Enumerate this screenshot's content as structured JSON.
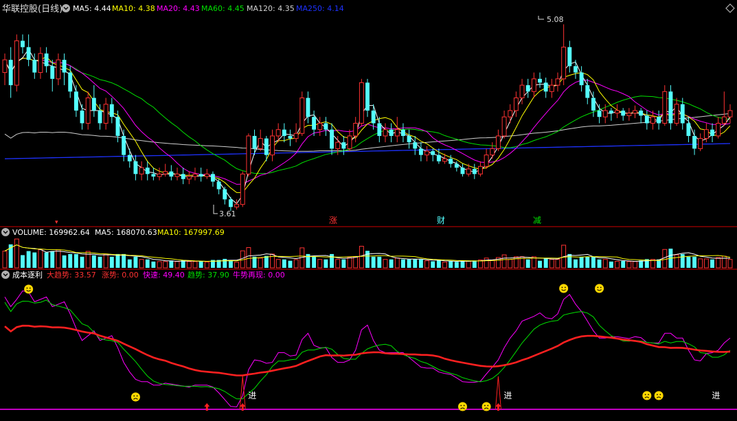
{
  "colors": {
    "background": "#000000",
    "up": "#ff3232",
    "down": "#54ffff",
    "divider": "#8b0000",
    "ma5": "#ffffff",
    "ma10": "#ffff00",
    "ma20": "#ff00ff",
    "ma60": "#00e000",
    "ma120": "#d0d0d0",
    "ma250": "#1e32ff"
  },
  "header": {
    "title": "华联控股(日线)",
    "ma5_label": "MA5: 4.44",
    "ma10_label": "MA10: 4.38",
    "ma20_label": "MA20: 4.43",
    "ma60_label": "MA60: 4.45",
    "ma120_label": "MA120: 4.35",
    "ma250_label": "MA250: 4.14"
  },
  "price_panel": {
    "high_annotation": "5.08",
    "low_annotation": "3.61",
    "markers": [
      {
        "text": "涨",
        "color": "#ff3232"
      },
      {
        "text": "财",
        "color": "#54ffff"
      },
      {
        "text": "减",
        "color": "#00e000"
      }
    ]
  },
  "volume_panel": {
    "volume_label": "VOLUME: 169962.64",
    "ma5_label": "MA5: 168070.63",
    "ma10_label": "MA10: 167997.69"
  },
  "indicator_panel": {
    "name": "成本逐利",
    "big_trend": "大趋势: 33.57",
    "rise": "涨势: 0.00",
    "fast": "快速: 49.40",
    "trend": "趋势: 37.90",
    "bull": "牛势再现: 0.00",
    "entry_label": "进"
  },
  "chart_data": [
    {
      "type": "candlestick",
      "title": "华联控股(日线)",
      "ylim": [
        3.55,
        5.12
      ],
      "high_marker": 5.08,
      "low_marker": 3.61,
      "current_ma": {
        "MA5": 4.44,
        "MA10": 4.38,
        "MA20": 4.43,
        "MA60": 4.45,
        "MA120": 4.35,
        "MA250": 4.14
      },
      "candles": [
        [
          4.7,
          4.8,
          4.85,
          4.6
        ],
        [
          4.8,
          4.6,
          4.9,
          4.5
        ],
        [
          4.6,
          4.95,
          5.0,
          4.55
        ],
        [
          4.95,
          4.9,
          5.0,
          4.85
        ],
        [
          4.9,
          4.8,
          5.0,
          4.75
        ],
        [
          4.8,
          4.7,
          4.85,
          4.65
        ],
        [
          4.7,
          4.85,
          4.9,
          4.65
        ],
        [
          4.85,
          4.75,
          4.9,
          4.7
        ],
        [
          4.75,
          4.65,
          4.8,
          4.55
        ],
        [
          4.65,
          4.8,
          4.85,
          4.6
        ],
        [
          4.8,
          4.7,
          4.85,
          4.6
        ],
        [
          4.7,
          4.55,
          4.75,
          4.5
        ],
        [
          4.55,
          4.4,
          4.6,
          4.35
        ],
        [
          4.4,
          4.3,
          4.45,
          4.25
        ],
        [
          4.3,
          4.5,
          4.55,
          4.25
        ],
        [
          4.5,
          4.4,
          4.6,
          4.35
        ],
        [
          4.4,
          4.3,
          4.45,
          4.25
        ],
        [
          4.3,
          4.45,
          4.5,
          4.25
        ],
        [
          4.45,
          4.35,
          4.5,
          4.3
        ],
        [
          4.35,
          4.2,
          4.4,
          4.15
        ],
        [
          4.2,
          4.05,
          4.25,
          4.0
        ],
        [
          4.05,
          4.0,
          4.1,
          3.95
        ],
        [
          4.0,
          3.9,
          4.05,
          3.85
        ],
        [
          3.9,
          3.95,
          4.0,
          3.85
        ],
        [
          3.95,
          3.9,
          4.0,
          3.85
        ],
        [
          3.9,
          3.88,
          3.95,
          3.85
        ],
        [
          3.88,
          3.9,
          3.95,
          3.85
        ],
        [
          3.9,
          3.92,
          3.98,
          3.88
        ],
        [
          3.92,
          3.88,
          3.97,
          3.85
        ],
        [
          3.88,
          3.9,
          3.95,
          3.85
        ],
        [
          3.9,
          3.86,
          3.95,
          3.82
        ],
        [
          3.86,
          3.88,
          3.92,
          3.82
        ],
        [
          3.88,
          3.9,
          3.95,
          3.85
        ],
        [
          3.9,
          3.88,
          3.95,
          3.84
        ],
        [
          3.88,
          3.9,
          3.94,
          3.86
        ],
        [
          3.9,
          3.84,
          3.92,
          3.8
        ],
        [
          3.84,
          3.78,
          3.86,
          3.74
        ],
        [
          3.78,
          3.7,
          3.8,
          3.66
        ],
        [
          3.7,
          3.64,
          3.72,
          3.61
        ],
        [
          3.64,
          3.66,
          3.7,
          3.62
        ],
        [
          3.66,
          3.9,
          3.92,
          3.64
        ],
        [
          3.9,
          4.2,
          4.22,
          3.88
        ],
        [
          4.2,
          4.1,
          4.25,
          4.05
        ],
        [
          4.1,
          4.18,
          4.25,
          4.08
        ],
        [
          4.18,
          4.05,
          4.2,
          4.0
        ],
        [
          4.05,
          4.2,
          4.25,
          4.0
        ],
        [
          4.2,
          4.25,
          4.3,
          4.15
        ],
        [
          4.25,
          4.2,
          4.3,
          4.15
        ],
        [
          4.2,
          4.18,
          4.25,
          4.12
        ],
        [
          4.18,
          4.22,
          4.3,
          4.15
        ],
        [
          4.22,
          4.5,
          4.55,
          4.2
        ],
        [
          4.5,
          4.35,
          4.55,
          4.3
        ],
        [
          4.35,
          4.25,
          4.4,
          4.2
        ],
        [
          4.25,
          4.3,
          4.35,
          4.2
        ],
        [
          4.3,
          4.25,
          4.35,
          4.2
        ],
        [
          4.25,
          4.1,
          4.3,
          4.05
        ],
        [
          4.1,
          4.15,
          4.2,
          4.05
        ],
        [
          4.15,
          4.1,
          4.2,
          4.05
        ],
        [
          4.1,
          4.2,
          4.25,
          4.08
        ],
        [
          4.2,
          4.3,
          4.35,
          4.15
        ],
        [
          4.3,
          4.62,
          4.65,
          4.28
        ],
        [
          4.62,
          4.4,
          4.65,
          4.35
        ],
        [
          4.4,
          4.3,
          4.45,
          4.25
        ],
        [
          4.3,
          4.2,
          4.35,
          4.15
        ],
        [
          4.2,
          4.25,
          4.3,
          4.15
        ],
        [
          4.25,
          4.2,
          4.3,
          4.15
        ],
        [
          4.2,
          4.25,
          4.35,
          4.15
        ],
        [
          4.25,
          4.2,
          4.3,
          4.15
        ],
        [
          4.2,
          4.15,
          4.25,
          4.1
        ],
        [
          4.15,
          4.1,
          4.2,
          4.05
        ],
        [
          4.1,
          4.05,
          4.15,
          4.0
        ],
        [
          4.05,
          4.08,
          4.12,
          4.0
        ],
        [
          4.08,
          4.05,
          4.1,
          4.0
        ],
        [
          4.05,
          4.0,
          4.1,
          3.98
        ],
        [
          4.0,
          4.02,
          4.06,
          3.98
        ],
        [
          4.02,
          3.98,
          4.05,
          3.95
        ],
        [
          3.98,
          3.95,
          4.0,
          3.92
        ],
        [
          3.95,
          3.9,
          3.98,
          3.88
        ],
        [
          3.9,
          3.94,
          3.98,
          3.88
        ],
        [
          3.94,
          3.9,
          3.98,
          3.86
        ],
        [
          3.9,
          3.96,
          4.0,
          3.88
        ],
        [
          3.96,
          4.05,
          4.1,
          3.94
        ],
        [
          4.05,
          4.1,
          4.15,
          4.02
        ],
        [
          4.1,
          4.2,
          4.25,
          4.08
        ],
        [
          4.2,
          4.35,
          4.4,
          4.18
        ],
        [
          4.35,
          4.4,
          4.45,
          4.3
        ],
        [
          4.4,
          4.5,
          4.55,
          4.35
        ],
        [
          4.5,
          4.6,
          4.65,
          4.45
        ],
        [
          4.6,
          4.55,
          4.65,
          4.5
        ],
        [
          4.55,
          4.65,
          4.7,
          4.5
        ],
        [
          4.65,
          4.62,
          4.7,
          4.58
        ],
        [
          4.62,
          4.55,
          4.66,
          4.5
        ],
        [
          4.55,
          4.6,
          4.65,
          4.5
        ],
        [
          4.6,
          4.65,
          4.7,
          4.55
        ],
        [
          4.65,
          4.9,
          5.08,
          4.6
        ],
        [
          4.9,
          4.75,
          4.95,
          4.7
        ],
        [
          4.75,
          4.7,
          4.8,
          4.65
        ],
        [
          4.7,
          4.6,
          4.75,
          4.55
        ],
        [
          4.6,
          4.5,
          4.65,
          4.45
        ],
        [
          4.5,
          4.4,
          4.55,
          4.35
        ],
        [
          4.4,
          4.35,
          4.45,
          4.3
        ],
        [
          4.35,
          4.4,
          4.45,
          4.3
        ],
        [
          4.4,
          4.38,
          4.42,
          4.32
        ],
        [
          4.38,
          4.4,
          4.45,
          4.34
        ],
        [
          4.4,
          4.36,
          4.42,
          4.32
        ],
        [
          4.36,
          4.38,
          4.42,
          4.32
        ],
        [
          4.38,
          4.4,
          4.44,
          4.34
        ],
        [
          4.4,
          4.36,
          4.42,
          4.3
        ],
        [
          4.36,
          4.3,
          4.4,
          4.25
        ],
        [
          4.3,
          4.35,
          4.4,
          4.25
        ],
        [
          4.35,
          4.3,
          4.4,
          4.25
        ],
        [
          4.3,
          4.55,
          4.6,
          4.28
        ],
        [
          4.55,
          4.3,
          4.6,
          4.25
        ],
        [
          4.3,
          4.45,
          4.5,
          4.28
        ],
        [
          4.45,
          4.3,
          4.5,
          4.25
        ],
        [
          4.3,
          4.2,
          4.35,
          4.15
        ],
        [
          4.2,
          4.1,
          4.25,
          4.05
        ],
        [
          4.1,
          4.18,
          4.22,
          4.08
        ],
        [
          4.18,
          4.25,
          4.3,
          4.15
        ],
        [
          4.25,
          4.2,
          4.3,
          4.15
        ],
        [
          4.2,
          4.3,
          4.35,
          4.18
        ],
        [
          4.3,
          4.35,
          4.55,
          4.28
        ],
        [
          4.35,
          4.4,
          4.45,
          4.3
        ]
      ]
    },
    {
      "type": "bar",
      "title": "VOLUME",
      "current": {
        "VOLUME": 169962.64,
        "MA5": 168070.63,
        "MA10": 167997.69
      }
    },
    {
      "type": "line",
      "title": "成本逐利",
      "series": [
        {
          "name": "大趋势",
          "current": 33.57
        },
        {
          "name": "涨势",
          "current": 0.0
        },
        {
          "name": "快速",
          "current": 49.4
        },
        {
          "name": "趋势",
          "current": 37.9
        },
        {
          "name": "牛势再现",
          "current": 0.0
        }
      ]
    }
  ]
}
